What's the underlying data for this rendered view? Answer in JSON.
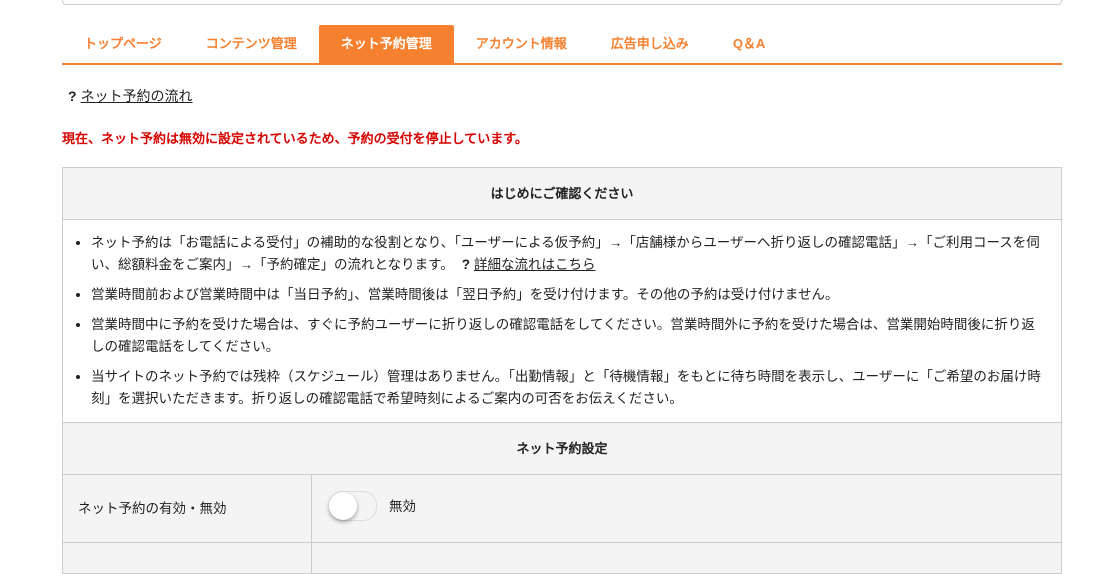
{
  "tabs": [
    {
      "label": "トップページ",
      "active": false
    },
    {
      "label": "コンテンツ管理",
      "active": false
    },
    {
      "label": "ネット予約管理",
      "active": true
    },
    {
      "label": "アカウント情報",
      "active": false
    },
    {
      "label": "広告申し込み",
      "active": false
    },
    {
      "label": "Q＆A",
      "active": false
    }
  ],
  "flow_link": {
    "icon": "?",
    "label": "ネット予約の流れ"
  },
  "warning": "現在、ネット予約は無効に設定されているため、予約の受付を停止しています。",
  "notice": {
    "title": "はじめにご確認ください",
    "items": [
      "ネット予約は「お電話による受付」の補助的な役割となり、「ユーザーによる仮予約」→「店舗様からユーザーへ折り返しの確認電話」→「ご利用コースを伺い、総額料金をご案内」→「予約確定」の流れとなります。",
      "営業時間前および営業時間中は「当日予約」、営業時間後は「翌日予約」を受け付けます。その他の予約は受け付けません。",
      "営業時間中に予約を受けた場合は、すぐに予約ユーザーに折り返しの確認電話をしてください。営業時間外に予約を受けた場合は、営業開始時間後に折り返しの確認電話をしてください。",
      "当サイトのネット予約では残枠（スケジュール）管理はありません。「出勤情報」と「待機情報」をもとに待ち時間を表示し、ユーザーに「ご希望のお届け時刻」を選択いただきます。折り返しの確認電話で希望時刻によるご案内の可否をお伝えください。"
    ],
    "detail_icon": "?",
    "detail_link": "詳細な流れはこちら"
  },
  "settings": {
    "title": "ネット予約設定",
    "enable_label": "ネット予約の有効・無効",
    "enable_value": "無効",
    "enabled": false
  },
  "colors": {
    "accent": "#f5802f",
    "warning": "#d50000"
  }
}
